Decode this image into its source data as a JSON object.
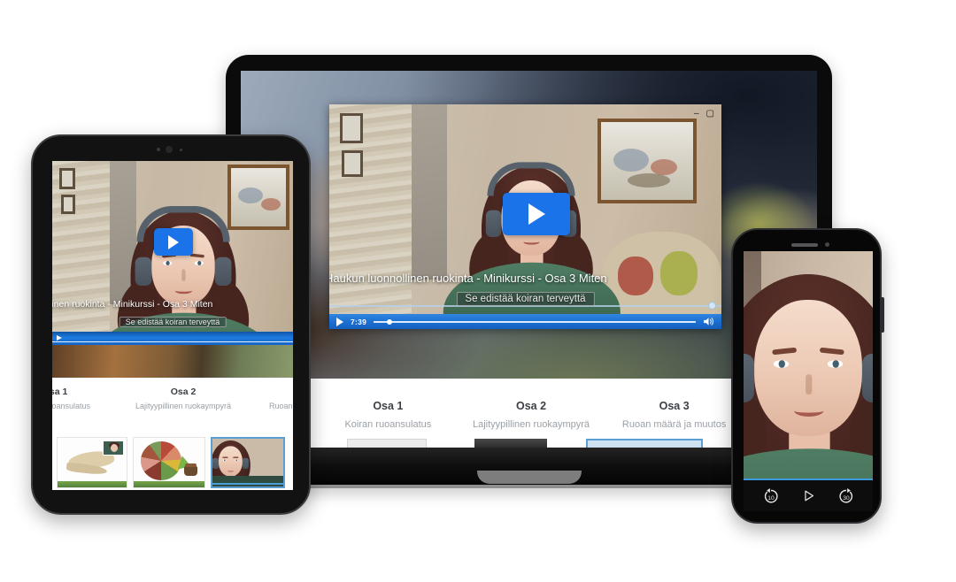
{
  "course": {
    "video_title": "Haukun luonnollinen ruokinta - Minikurssi - Osa 3 Miten",
    "caption": "Se edistää koiran terveyttä",
    "sections": [
      {
        "label": "Osa 1",
        "title": "Koiran ruoansulatus"
      },
      {
        "label": "Osa 2",
        "title": "Lajityypillinen ruokaympyrä"
      },
      {
        "label": "Osa 3",
        "title": "Ruoan määrä ja muutos"
      }
    ]
  },
  "laptop": {
    "player": {
      "time": "7:39"
    },
    "window_controls": {
      "minimize": "–",
      "maximize": "▢"
    }
  },
  "phone": {
    "controls": {
      "rewind_seconds": "10",
      "forward_seconds": "30"
    }
  },
  "colors": {
    "player_bar_blue": "#1b6ed2",
    "play_button_blue": "#1a73e8",
    "selected_thumb_border": "#5a9fd4",
    "progress_line_blue": "#3e9ade",
    "thumbnail_progress_green": "#54823a"
  }
}
